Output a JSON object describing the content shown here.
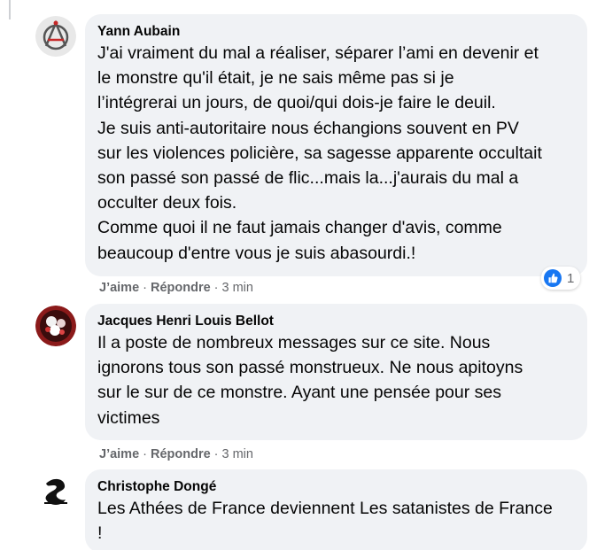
{
  "comments": [
    {
      "author": "Yann Aubain",
      "avatar_icon": "anarchy-atheist-symbol-icon",
      "text": "J'ai vraiment du mal a réaliser, séparer l’ami en devenir et\nle monstre qu'il était, je ne sais même pas si je\nl’intégrerai un jours, de quoi/qui dois-je faire le deuil.\nJe suis anti-autoritaire nous échangions souvent en PV\nsur les violences policière, sa sagesse apparente occultait\nson passé son passé de flic...mais la...j'aurais du mal a\nocculter deux fois.\nComme quoi il ne faut jamais changer d'avis, comme\nbeaucoup d'entre vous je suis abasourdi.!",
      "like_label": "J’aime",
      "reply_label": "Répondre",
      "separator": "·",
      "time": "3 min",
      "reaction": {
        "icon": "thumbs-up-icon",
        "count": "1"
      }
    },
    {
      "author": "Jacques Henri Louis Bellot",
      "avatar_icon": "flower-photo-avatar",
      "text": "Il a poste de nombreux messages sur ce site. Nous\nignorons tous son passé monstrueux. Ne nous apitoyns\nsur le sur de ce monstre. Ayant une pensée pour ses\nvictimes",
      "like_label": "J’aime",
      "reply_label": "Répondre",
      "separator": "·",
      "time": "3 min"
    },
    {
      "author": "Christophe Dongé",
      "avatar_icon": "ink-logo-avatar",
      "text": "Les Athées de France deviennent Les satanistes de France\n!"
    }
  ],
  "colors": {
    "bubble_bg": "#f0f2f5",
    "text": "#050505",
    "secondary_text": "#65676b",
    "like_blue": "#1877f2"
  }
}
